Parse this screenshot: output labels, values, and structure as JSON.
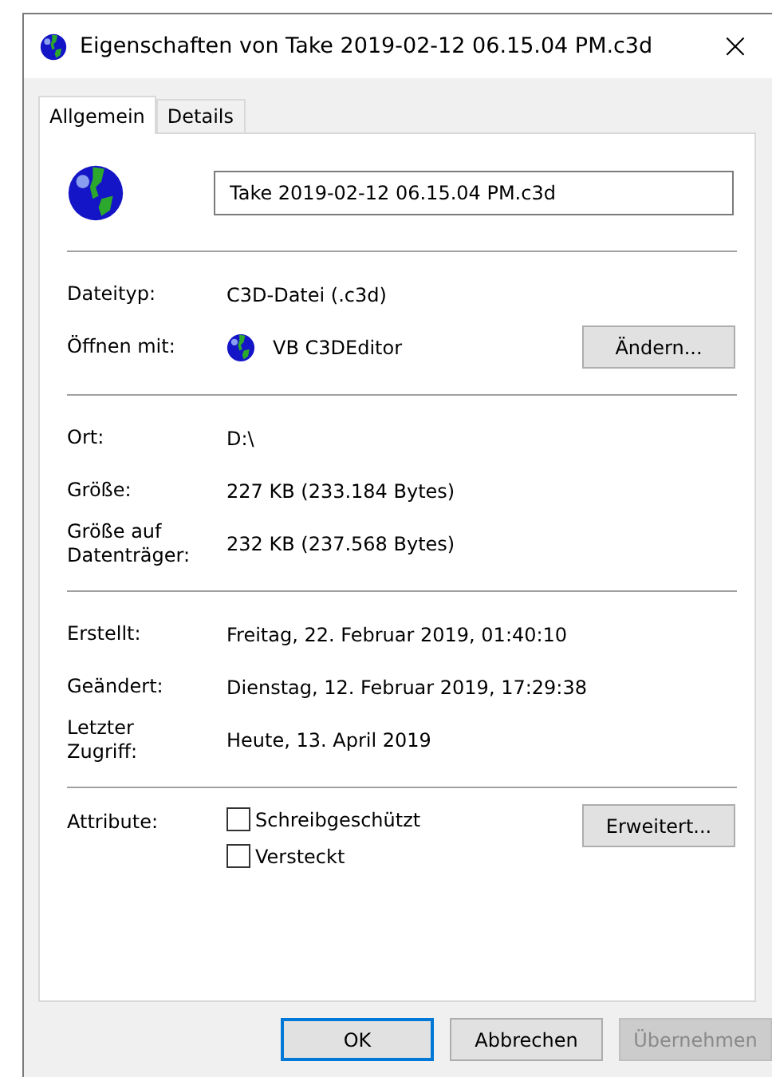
{
  "window": {
    "title": "Eigenschaften von Take 2019-02-12 06.15.04 PM.c3d",
    "close": "×"
  },
  "tabs": [
    {
      "label": "Allgemein",
      "selected": true
    },
    {
      "label": "Details",
      "selected": false
    }
  ],
  "file_name": "Take 2019-02-12 06.15.04 PM.c3d",
  "sections": [
    [
      {
        "label": "Dateityp:",
        "value": "C3D-Datei (.c3d)",
        "kind": "text"
      },
      {
        "label": "Öffnen mit:",
        "value": "VB C3DEditor",
        "kind": "app",
        "button": "Ändern..."
      }
    ],
    [
      {
        "label": "Ort:",
        "value": "D:\\",
        "kind": "text"
      },
      {
        "label": "Größe:",
        "value": "227 KB (233.184 Bytes)",
        "kind": "text"
      },
      {
        "label": "Größe auf Datenträger:",
        "value": "232 KB (237.568 Bytes)",
        "kind": "text"
      }
    ],
    [
      {
        "label": "Erstellt:",
        "value": "Freitag, 22. Februar 2019, 01:40:10",
        "kind": "text"
      },
      {
        "label": "Geändert:",
        "value": "Dienstag, 12. Februar 2019, 17:29:38",
        "kind": "text"
      },
      {
        "label": "Letzter Zugriff:",
        "value": "Heute, 13. April 2019",
        "kind": "text"
      }
    ]
  ],
  "attributes": {
    "label": "Attribute:",
    "button": "Erweitert...",
    "options": [
      {
        "label": "Schreibgeschützt",
        "checked": false
      },
      {
        "label": "Versteckt",
        "checked": false
      }
    ]
  },
  "buttons": [
    {
      "label": "OK",
      "default": true,
      "disabled": false
    },
    {
      "label": "Abbrechen",
      "default": false,
      "disabled": false
    },
    {
      "label": "Übernehmen",
      "default": false,
      "disabled": true
    }
  ]
}
